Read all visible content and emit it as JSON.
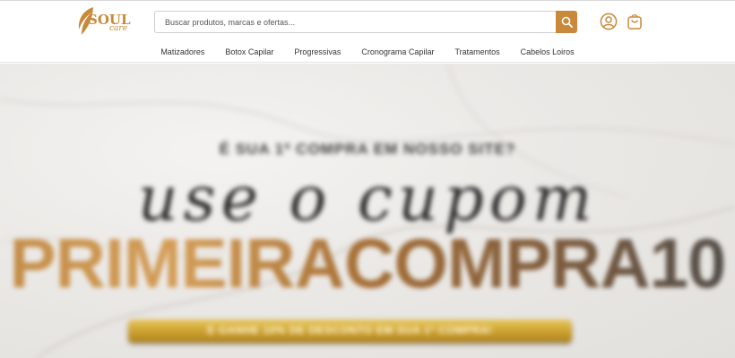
{
  "brand": {
    "name": "SOUL",
    "sub": "care",
    "accent": "#c9893a"
  },
  "search": {
    "placeholder": "Buscar produtos, marcas e ofertas...",
    "value": ""
  },
  "header_icons": [
    "search-icon",
    "user-icon",
    "shopping-bag-icon"
  ],
  "nav": {
    "items": [
      {
        "label": "Matizadores"
      },
      {
        "label": "Botox Capilar"
      },
      {
        "label": "Progressivas"
      },
      {
        "label": "Cronograma Capilar"
      },
      {
        "label": "Tratamentos"
      },
      {
        "label": "Cabelos Loiros"
      }
    ]
  },
  "hero": {
    "kicker": "É SUA 1ª COMPRA EM NOSSO SITE?",
    "script": "use o cupom",
    "coupon": "PRIMEIRACOMPRA10",
    "ribbon": "E GANHE 10% DE DESCONTO EM SUA 1ª COMPRA!"
  }
}
